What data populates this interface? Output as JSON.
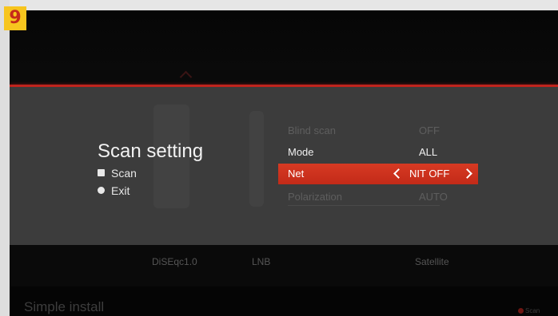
{
  "badge": "9",
  "menu": {
    "title": "Scan setting",
    "help": [
      {
        "icon": "square-button-icon",
        "label": "Scan"
      },
      {
        "icon": "circle-button-icon",
        "label": "Exit"
      }
    ],
    "rows": [
      {
        "label": "Blind scan",
        "value": "OFF",
        "state": "dim"
      },
      {
        "label": "Mode",
        "value": "ALL",
        "state": "normal"
      },
      {
        "label": "Net",
        "value": "NIT OFF",
        "state": "selected"
      },
      {
        "label": "Polarization",
        "value": "AUTO",
        "state": "dim"
      }
    ]
  },
  "background_tabs": [
    "DiSEqc1.0",
    "LNB",
    "Satellite"
  ],
  "footer": {
    "title": "Simple install",
    "hint": "Scan"
  },
  "colors": {
    "accent": "#c0241d",
    "panel": "#3c3c3c",
    "badge_bg": "#f7c51e",
    "badge_fg": "#c62a1a"
  }
}
